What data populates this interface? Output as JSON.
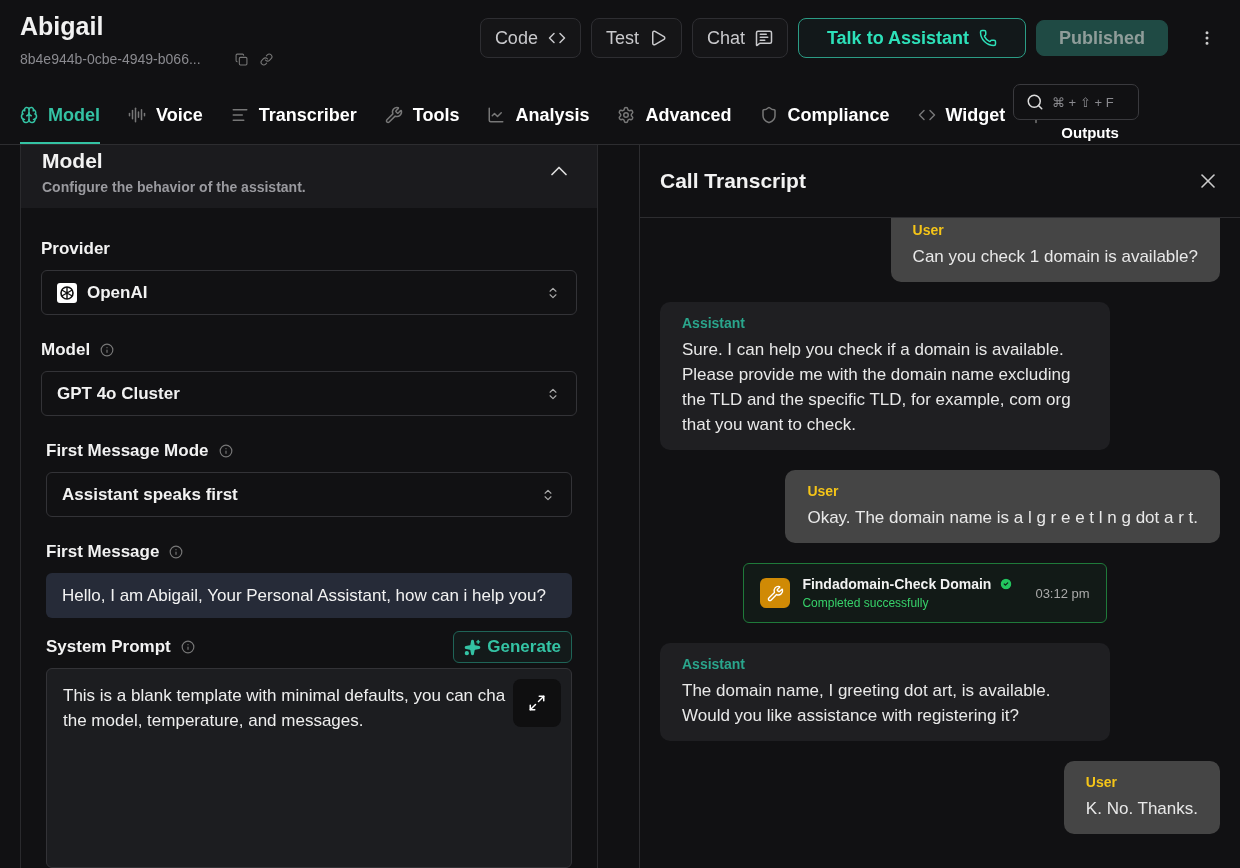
{
  "assistant": {
    "name": "Abigail",
    "id": "8b4e944b-0cbe-4949-b066..."
  },
  "actions": [
    {
      "label": "Code",
      "kind": "code"
    },
    {
      "label": "Test",
      "kind": "test"
    },
    {
      "label": "Chat",
      "kind": "chat"
    },
    {
      "label": "Talk to Assistant",
      "kind": "talk"
    },
    {
      "label": "Published",
      "kind": "publish"
    }
  ],
  "tabs": [
    {
      "label": "Model",
      "kind": "model",
      "selected": true
    },
    {
      "label": "Voice",
      "kind": "voice",
      "selected": false
    },
    {
      "label": "Transcriber",
      "kind": "transcriber",
      "selected": false
    },
    {
      "label": "Tools",
      "kind": "tools",
      "selected": false
    },
    {
      "label": "Analysis",
      "kind": "analysis",
      "selected": false
    },
    {
      "label": "Advanced",
      "kind": "advanced",
      "selected": false
    },
    {
      "label": "Compliance",
      "kind": "compliance",
      "selected": false
    },
    {
      "label": "Widget",
      "kind": "widget",
      "selected": false
    },
    {
      "label": "Outputs",
      "kind": "outputs",
      "selected": false
    }
  ],
  "search": {
    "shortcut": "⌘ + ⇧ + F"
  },
  "model_section": {
    "title": "Model",
    "subtitle": "Configure the behavior of the assistant.",
    "expanded": true,
    "provider": {
      "label": "Provider",
      "value": "OpenAI"
    },
    "model": {
      "label": "Model",
      "value": "GPT 4o Cluster"
    },
    "first_message_mode": {
      "label": "First Message Mode",
      "value": "Assistant speaks first"
    },
    "first_message": {
      "label": "First Message",
      "value": "Hello, I am Abigail, Your Personal Assistant, how can i help you?"
    },
    "system_prompt": {
      "label": "System Prompt",
      "button": "Generate",
      "value": "This is a blank template with minimal defaults, you can cha\nthe model, temperature, and messages."
    }
  },
  "transcript": {
    "title": "Call Transcript",
    "messages": [
      {
        "kind": "user",
        "role": "User",
        "text": "Can you check 1 domain is available?"
      },
      {
        "kind": "assistant",
        "role": "Assistant",
        "text": "Sure. I can help you check if a domain is available. Please provide me with the domain name excluding the TLD and the specific TLD, for example, com org that you want to check."
      },
      {
        "kind": "user",
        "role": "User",
        "text": "Okay. The domain name is a l g r e e t l n g dot a r t."
      },
      {
        "kind": "tool",
        "name": "Findadomain-Check Domain",
        "status": "Completed successfully",
        "time": "03:12 pm"
      },
      {
        "kind": "assistant",
        "role": "Assistant",
        "text": "The domain name, I greeting dot art, is available. Would you like assistance with registering it?"
      },
      {
        "kind": "user",
        "role": "User",
        "text": "K. No. Thanks."
      }
    ]
  }
}
